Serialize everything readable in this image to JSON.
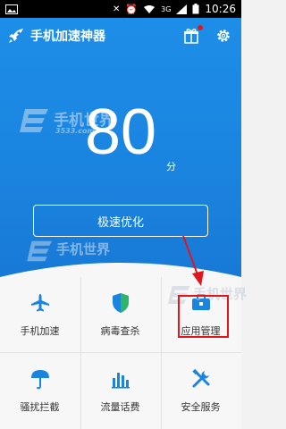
{
  "status_bar": {
    "time": "10:26",
    "network": "3G"
  },
  "header": {
    "title": "手机加速神器"
  },
  "score": {
    "value": "80",
    "unit": "分"
  },
  "optimize_button": {
    "label": "极速优化"
  },
  "tools": [
    {
      "label": "手机加速",
      "icon": "airplane-icon"
    },
    {
      "label": "病毒查杀",
      "icon": "shield-icon"
    },
    {
      "label": "应用管理",
      "icon": "toolbox-icon"
    },
    {
      "label": "骚扰拦截",
      "icon": "umbrella-icon"
    },
    {
      "label": "流量话费",
      "icon": "bar-chart-icon"
    },
    {
      "label": "安全服务",
      "icon": "tools-icon"
    }
  ],
  "watermarks": [
    {
      "text": "手机世界"
    },
    {
      "text": "3533.com"
    }
  ],
  "colors": {
    "primary": "#1a84df",
    "accent": "#e0161f"
  }
}
